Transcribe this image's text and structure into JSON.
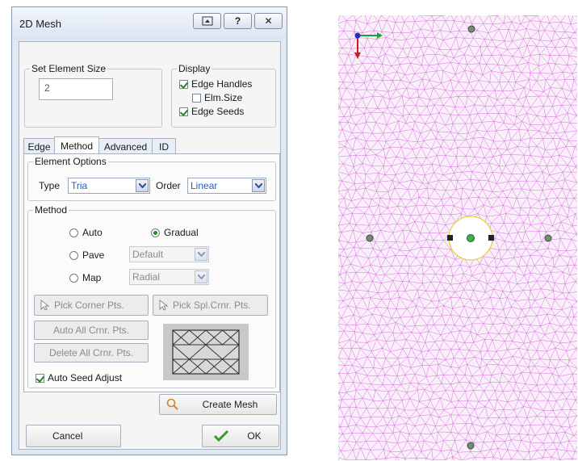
{
  "dialog": {
    "title": "2D Mesh",
    "titlebar_buttons": {
      "restore_icon": "restore-icon",
      "help_label": "?",
      "close_label": "✕"
    },
    "set_element_size": {
      "legend": "Set Element Size",
      "value": "2"
    },
    "display": {
      "legend": "Display",
      "edge_handles": {
        "label": "Edge Handles",
        "checked": true
      },
      "elm_size": {
        "label": "Elm.Size",
        "checked": false
      },
      "edge_seeds": {
        "label": "Edge Seeds",
        "checked": true
      }
    },
    "tabs": [
      {
        "label": "Edge"
      },
      {
        "label": "Method",
        "active": true
      },
      {
        "label": "Advanced"
      },
      {
        "label": "ID"
      }
    ],
    "element_options": {
      "legend": "Element Options",
      "type_label": "Type",
      "type_value": "Tria",
      "order_label": "Order",
      "order_value": "Linear"
    },
    "method": {
      "legend": "Method",
      "auto_label": "Auto",
      "gradual_label": "Gradual",
      "pave_label": "Pave",
      "pave_option": "Default",
      "map_label": "Map",
      "map_option": "Radial",
      "selected": "Gradual"
    },
    "buttons": {
      "pick_corner": "Pick Corner Pts.",
      "pick_spl_corner": "Pick Spl.Crnr. Pts.",
      "auto_all": "Auto All Crnr. Pts.",
      "delete_all": "Delete All Crnr. Pts."
    },
    "auto_seed_adjust": {
      "label": "Auto Seed Adjust",
      "checked": true
    },
    "create_mesh": "Create Mesh",
    "cancel": "Cancel",
    "ok": "OK"
  },
  "colors": {
    "mesh_line": "#d070d8",
    "mesh_bg": "#fbeefb",
    "hole_outline": "#e8d23a",
    "node": "#6f8f6f",
    "accent_check": "#1d8a1d"
  }
}
